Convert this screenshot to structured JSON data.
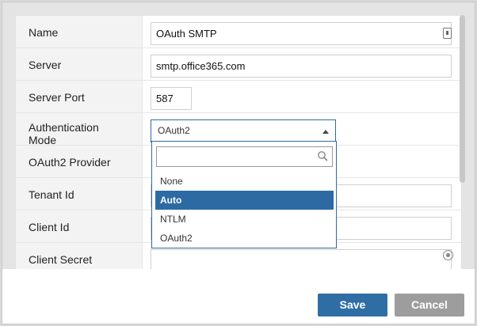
{
  "form": {
    "rows": [
      {
        "label": "Name"
      },
      {
        "label": "Server"
      },
      {
        "label": "Server Port"
      },
      {
        "label": "Authentication Mode"
      },
      {
        "label": "OAuth2 Provider"
      },
      {
        "label": "Tenant Id"
      },
      {
        "label": "Client Id"
      },
      {
        "label": "Client Secret"
      }
    ],
    "name_value": "OAuth SMTP",
    "server_value": "smtp.office365.com",
    "port_value": "587",
    "auth_mode_value": "OAuth2"
  },
  "dropdown": {
    "search_value": "",
    "options": [
      "None",
      "Auto",
      "NTLM",
      "OAuth2"
    ],
    "highlighted": "Auto"
  },
  "buttons": {
    "save_label": "Save",
    "cancel_label": "Cancel"
  },
  "icons": {
    "address_book": "address-book-icon",
    "search": "search-icon",
    "eye": "eye-icon",
    "caret": "caret-up-icon"
  },
  "colors": {
    "accent": "#2d6aa3",
    "save_bg": "#2f6ea5",
    "cancel_bg": "#9d9d9d"
  }
}
